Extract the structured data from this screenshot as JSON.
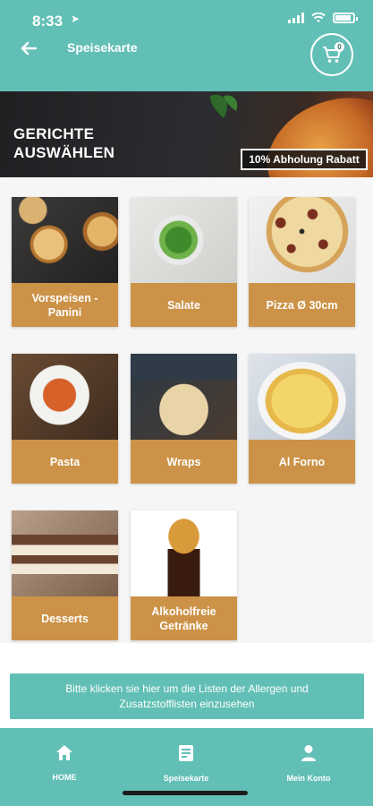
{
  "status_bar": {
    "time": "8:33",
    "location_icon": "location-arrow-icon",
    "icons": [
      "signal-icon",
      "wifi-icon",
      "battery-icon"
    ]
  },
  "header": {
    "title": "Speisekarte",
    "back_icon": "arrow-left-icon",
    "cart_icon": "shopping-cart-icon",
    "cart_count": "0"
  },
  "banner": {
    "title_line1": "GERICHTE",
    "title_line2": "AUSWÄHLEN",
    "badge": "10% Abholung Rabatt"
  },
  "categories": [
    {
      "label": "Vorspeisen - Panini"
    },
    {
      "label": "Salate"
    },
    {
      "label": "Pizza Ø 30cm"
    },
    {
      "label": "Pasta"
    },
    {
      "label": "Wraps"
    },
    {
      "label": "Al Forno"
    },
    {
      "label": "Desserts"
    },
    {
      "label": "Alkoholfreie Getränke"
    }
  ],
  "allergen_notice": "Bitte klicken sie hier um die Listen der Allergen und Zusatzstofflisten einzusehen",
  "bottom_nav": [
    {
      "label": "HOME",
      "icon": "home-icon"
    },
    {
      "label": "Speisekarte",
      "icon": "menu-document-icon"
    },
    {
      "label": "Mein Konto",
      "icon": "user-icon"
    }
  ],
  "colors": {
    "primary": "#62bfb6",
    "card_label": "#cc9247",
    "banner": "#2b2d30"
  }
}
